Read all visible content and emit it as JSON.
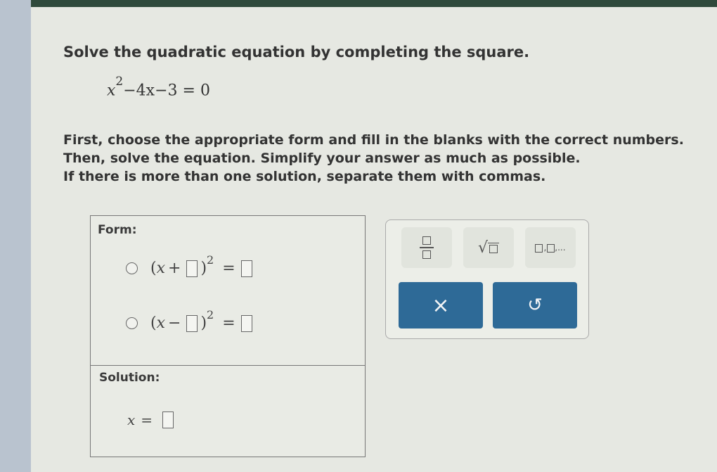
{
  "question": {
    "prompt": "Solve the quadratic equation by completing the square.",
    "equation": {
      "variable": "x",
      "exponent": "2",
      "rest": "−4x−3 = 0"
    },
    "instructions": [
      "First, choose the appropriate form and fill in the blanks with the correct numbers.",
      "Then, solve the equation. Simplify your answer as much as possible.",
      "If there is more than one solution, separate them with commas."
    ]
  },
  "form_box": {
    "label": "Form:",
    "options": [
      {
        "open": "(",
        "var": "x",
        "sign": "+",
        "close": ")",
        "exp": "2",
        "eq": "="
      },
      {
        "open": "(",
        "var": "x",
        "sign": "−",
        "close": ")",
        "exp": "2",
        "eq": "="
      }
    ]
  },
  "solution_box": {
    "label": "Solution:",
    "var": "x",
    "eq": "="
  },
  "tool_panel": {
    "fraction_button": "fraction-icon",
    "sqrt_button": "sqrt-icon",
    "list_button": "list-icon",
    "list_glyph": ",...",
    "clear_label": "×",
    "undo_label": "↺"
  }
}
